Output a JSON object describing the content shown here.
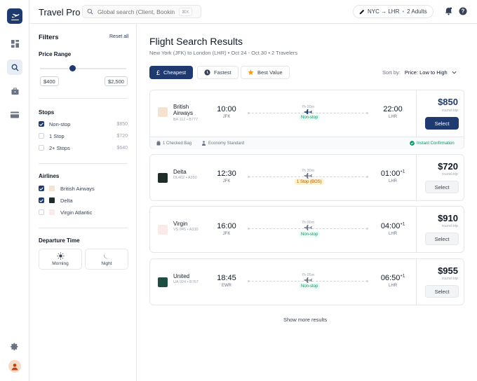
{
  "app": {
    "name": "Travel Pro"
  },
  "search": {
    "placeholder": "Global search (Client, Booking ID...)",
    "shortcut": "⌘K"
  },
  "trip": {
    "route": "NYC → LHR",
    "separator": "•",
    "travelers": "2 Adults"
  },
  "rail": {
    "items": [
      "dashboard-icon",
      "search-icon",
      "briefcase-icon",
      "credit-card-icon"
    ],
    "active": "search-icon",
    "bottom": [
      "settings-icon",
      "avatar"
    ]
  },
  "filters": {
    "title": "Filters",
    "reset": "Reset all",
    "price": {
      "title": "Price Range",
      "min": "$400",
      "max": "$2,500",
      "level": 0.38
    },
    "stops": {
      "title": "Stops",
      "options": [
        {
          "label": "Non-stop",
          "price": "$850",
          "checked": true
        },
        {
          "label": "1 Stop",
          "price": "$720",
          "checked": false
        },
        {
          "label": "2+ Stops",
          "price": "$640",
          "checked": false
        }
      ]
    },
    "airlines": {
      "title": "Airlines",
      "options": [
        {
          "label": "British Airways",
          "checked": true
        },
        {
          "label": "Delta",
          "checked": true
        },
        {
          "label": "Virgin Atlantic",
          "checked": false
        }
      ]
    },
    "departure": {
      "title": "Departure Time",
      "options": [
        {
          "label": "Morning",
          "icon": "sun-icon"
        },
        {
          "label": "Night",
          "icon": "moon-icon"
        }
      ]
    }
  },
  "results": {
    "title": "Flight Search Results",
    "subtitle": "New York (JFK) to London (LHR) • Oct 24 - Oct 30 • 2 Travelers",
    "sort_buttons": [
      {
        "label": "Cheapest",
        "icon": "pound-icon",
        "active": true
      },
      {
        "label": "Fastest",
        "icon": "clock-icon",
        "active": false
      },
      {
        "label": "Best Value",
        "icon": "star-icon",
        "active": false
      }
    ],
    "sort_by": {
      "label": "Sort by:",
      "value": "Price: Low to High"
    },
    "flights": [
      {
        "airline": "British Airways",
        "code": "BA 112 • B777",
        "depart": "10:00",
        "from": "JFK",
        "arrive": "22:00",
        "next_day": "",
        "to": "LHR",
        "duration": "7h 00m",
        "stops": "Non-stop",
        "price": "$850",
        "price_note": "round trip",
        "select": "Select",
        "primary": true,
        "logo_color": "#f3e3d0",
        "footer": {
          "bag": "1 Checked Bag",
          "cabin": "Economy Standard",
          "confirm": "Instant Confirmation"
        }
      },
      {
        "airline": "Delta",
        "code": "DL402 • A350",
        "depart": "12:30",
        "from": "JFK",
        "arrive": "01:00",
        "next_day": "+1",
        "to": "LHR",
        "duration": "7h 30m",
        "stops": "1 Stop (BOS)",
        "price": "$720",
        "price_note": "round trip",
        "select": "Select",
        "primary": false,
        "logo_color": "#1f2d2a"
      },
      {
        "airline": "Virgin",
        "code": "VS 045 • A330",
        "depart": "16:00",
        "from": "JFK",
        "arrive": "04:00",
        "next_day": "+1",
        "to": "LHR",
        "duration": "7h 00m",
        "stops": "Non-stop",
        "price": "$910",
        "price_note": "round trip",
        "select": "Select",
        "primary": false,
        "logo_color": "#fbeaea"
      },
      {
        "airline": "United",
        "code": "UA 924 • B767",
        "depart": "18:45",
        "from": "EWR",
        "arrive": "06:50",
        "next_day": "+1",
        "to": "LHR",
        "duration": "7h 05m",
        "stops": "Non-stop",
        "price": "$955",
        "price_note": "round trip",
        "select": "Select",
        "primary": false,
        "logo_color": "#1e4d44"
      }
    ],
    "show_more": "Show more results"
  },
  "colors": {
    "accent": "#1e3a6e",
    "nonstop": "#059669",
    "one_stop": "#b45309",
    "star": "#f59e0b"
  }
}
